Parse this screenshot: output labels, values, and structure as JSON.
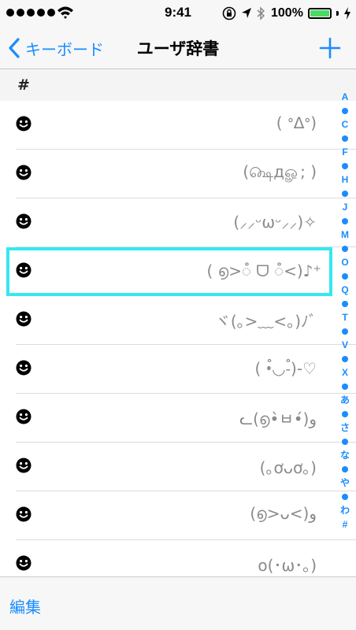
{
  "status_bar": {
    "time": "9:41",
    "battery": "100%",
    "icons": [
      "signal-dots",
      "wifi-icon",
      "orientation-lock-icon",
      "location-icon",
      "bluetooth-icon",
      "battery-icon",
      "charging-icon"
    ]
  },
  "nav": {
    "back_label": "キーボード",
    "title": "ユーザ辞書",
    "add_icon": "plus-icon"
  },
  "section": {
    "header": "#"
  },
  "entries": [
    {
      "icon": "smiley-icon",
      "phrase": "( ᐤᐃᐤ)"
    },
    {
      "icon": "smiley-icon",
      "phrase": "(௸дௐ; )"
    },
    {
      "icon": "smiley-icon",
      "phrase": "(⸝⸝ᵕωᵕ⸝⸝)✧"
    },
    {
      "icon": "smiley-icon",
      "phrase": "( ൭>ꠋ ᗜ ꠋ<)♪⁺",
      "highlighted": true
    },
    {
      "icon": "smiley-icon",
      "phrase": "ヾ(｡>﹏<｡)ﾉﾞ"
    },
    {
      "icon": "smiley-icon",
      "phrase": "( •ꠋ◡-ꠋ)-♡"
    },
    {
      "icon": "smiley-icon",
      "phrase": "ᓚ(൭•̀ㅂ•́)و"
    },
    {
      "icon": "smiley-icon",
      "phrase": "(｡ơᴗơ｡)"
    },
    {
      "icon": "smiley-icon",
      "phrase": "(൭>ᴗ<)و"
    },
    {
      "icon": "smiley-icon",
      "phrase": "o(･ω･｡)"
    }
  ],
  "index": [
    "A",
    "•",
    "C",
    "•",
    "F",
    "•",
    "H",
    "•",
    "J",
    "•",
    "M",
    "•",
    "O",
    "•",
    "Q",
    "•",
    "T",
    "•",
    "V",
    "•",
    "X",
    "•",
    "あ",
    "•",
    "さ",
    "•",
    "な",
    "•",
    "や",
    "•",
    "わ",
    "#"
  ],
  "toolbar": {
    "edit_label": "編集"
  },
  "colors": {
    "accent": "#1a8cff",
    "highlight": "#35e8f0",
    "battery_fill": "#4cd964"
  }
}
